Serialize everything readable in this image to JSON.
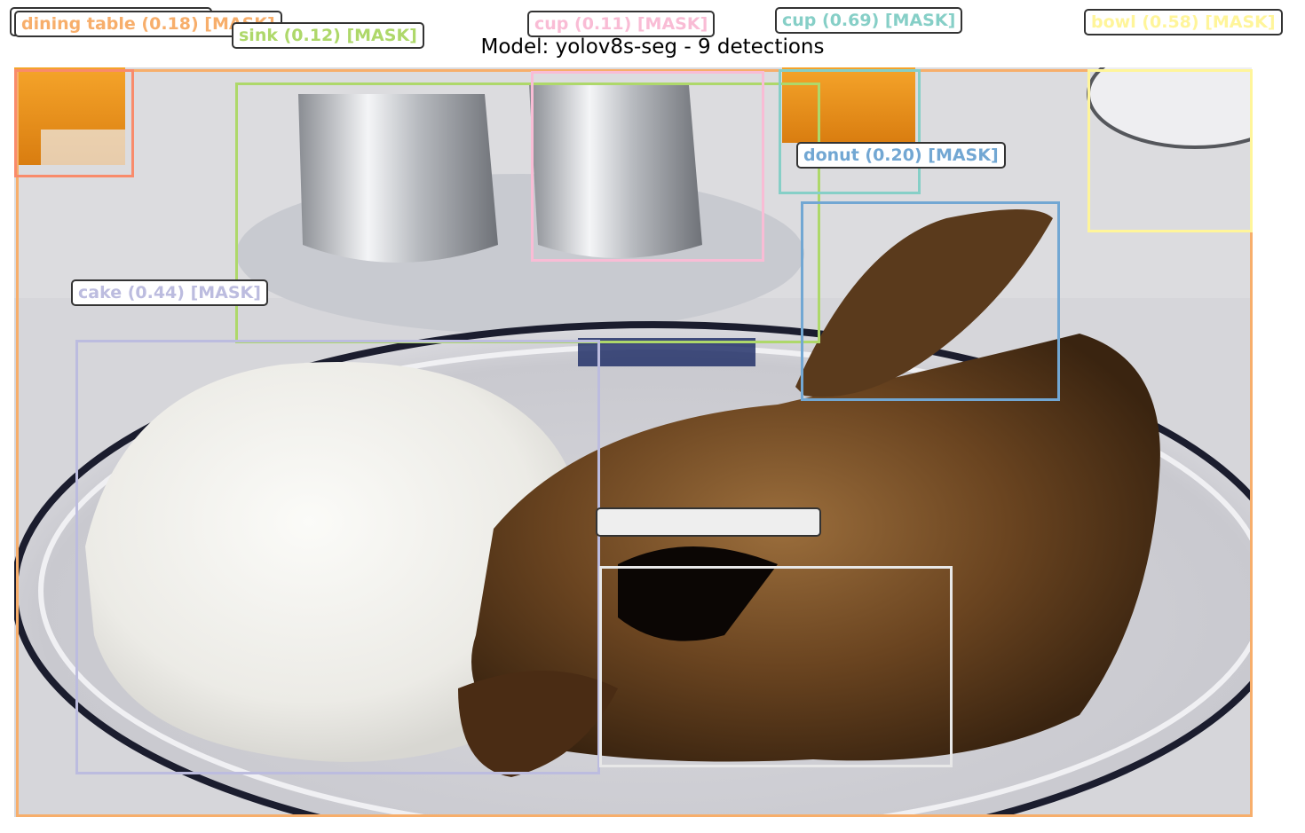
{
  "figure": {
    "title": "Model: yolov8s-seg - 9 detections"
  },
  "detections": [
    {
      "label": "dining table (0.18) [MASK]",
      "color": "#f7ae6b"
    },
    {
      "label": "sink (0.12) [MASK]",
      "color": "#aed86a"
    },
    {
      "label": "cup (0.11) [MASK]",
      "color": "#f9bcd5"
    },
    {
      "label": "cup (0.69) [MASK]",
      "color": "#86cfc7"
    },
    {
      "label": "bowl (0.58) [MASK]",
      "color": "#fff59a"
    },
    {
      "label": "donut (0.20) [MASK]",
      "color": "#72a7d3"
    },
    {
      "label": "cake (0.44) [MASK]",
      "color": "#bcbcdf"
    },
    {
      "label": "",
      "color": "#e8e8e8"
    },
    {
      "label": "",
      "color": "#f98b6b"
    }
  ]
}
